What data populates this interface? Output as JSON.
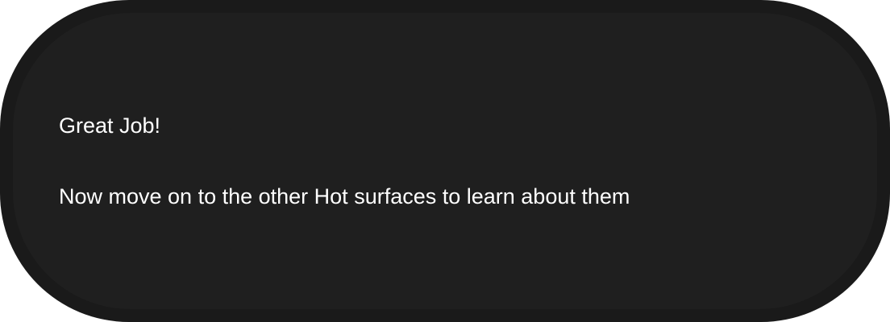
{
  "toast": {
    "title": "Great Job!",
    "message": "Now move on to the other Hot surfaces to learn about them",
    "colors": {
      "frame": "#1a1a1a",
      "background": "#1f1f1f",
      "text": "#ffffff"
    }
  }
}
